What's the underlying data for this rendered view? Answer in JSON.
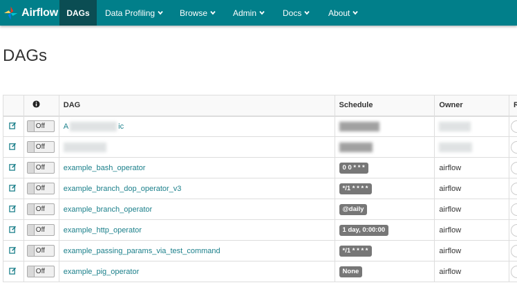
{
  "navbar": {
    "brand": "Airflow",
    "items": [
      {
        "label": "DAGs",
        "active": true
      },
      {
        "label": "Data Profiling",
        "dropdown": true
      },
      {
        "label": "Browse",
        "dropdown": true
      },
      {
        "label": "Admin",
        "dropdown": true
      },
      {
        "label": "Docs",
        "dropdown": true
      },
      {
        "label": "About",
        "dropdown": true
      }
    ]
  },
  "page": {
    "title": "DAGs"
  },
  "table": {
    "headers": {
      "dag": "DAG",
      "schedule": "Schedule",
      "owner": "Owner",
      "r": "R"
    },
    "rows": [
      {
        "toggle": "Off",
        "dag": "A",
        "dag_suffix": "ic",
        "schedule": "",
        "owner": ""
      },
      {
        "toggle": "Off",
        "dag": "",
        "dag_suffix": "",
        "schedule": "",
        "owner": ""
      },
      {
        "toggle": "Off",
        "dag": "example_bash_operator",
        "schedule": "0 0 * * *",
        "owner": "airflow"
      },
      {
        "toggle": "Off",
        "dag": "example_branch_dop_operator_v3",
        "schedule": "*/1 * * * *",
        "owner": "airflow"
      },
      {
        "toggle": "Off",
        "dag": "example_branch_operator",
        "schedule": "@daily",
        "owner": "airflow"
      },
      {
        "toggle": "Off",
        "dag": "example_http_operator",
        "schedule": "1 day, 0:00:00",
        "owner": "airflow"
      },
      {
        "toggle": "Off",
        "dag": "example_passing_params_via_test_command",
        "schedule": "*/1 * * * *",
        "owner": "airflow"
      },
      {
        "toggle": "Off",
        "dag": "example_pig_operator",
        "schedule": "None",
        "owner": "airflow"
      }
    ]
  },
  "colors": {
    "navbar": "#017f8a",
    "active_tab": "#0b4d53",
    "link": "#1a7f8a",
    "badge": "#777777"
  }
}
